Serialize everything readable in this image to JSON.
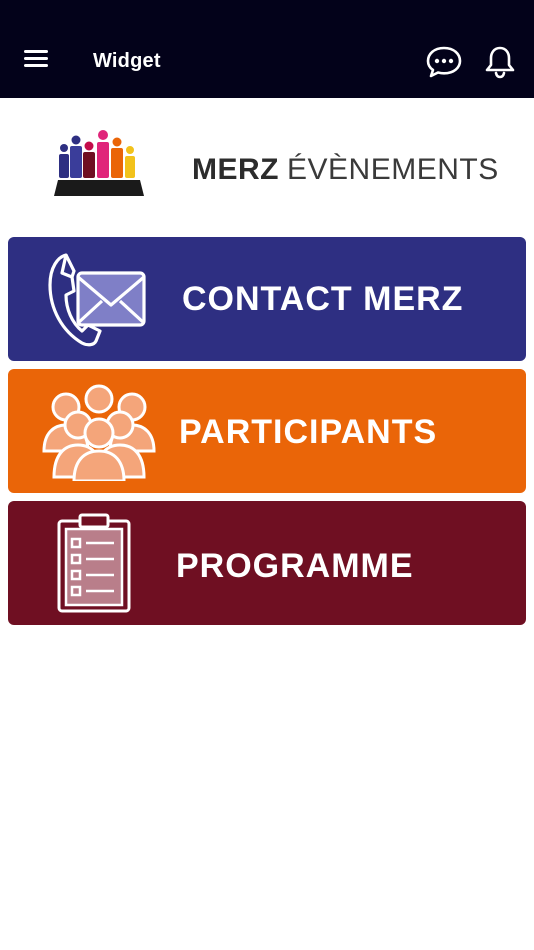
{
  "header": {
    "title": "Widget",
    "background": "#03021a",
    "menu_icon": "hamburger-menu-icon",
    "chat_icon": "chat-bubble-icon",
    "bell_icon": "bell-icon"
  },
  "logo": {
    "brand": "MERZ",
    "subtitle": "ÉVÈNEMENTS"
  },
  "tiles": [
    {
      "label": "CONTACT MERZ",
      "color": "#2e2f82",
      "icon": "phone-envelope-icon"
    },
    {
      "label": "PARTICIPANTS",
      "color": "#ea6508",
      "icon": "people-group-icon"
    },
    {
      "label": "PROGRAMME",
      "color": "#6f0f22",
      "icon": "clipboard-checklist-icon"
    }
  ]
}
